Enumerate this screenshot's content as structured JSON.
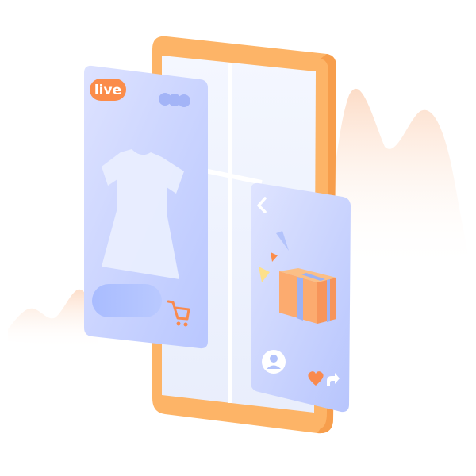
{
  "live_card": {
    "badge_text": "live",
    "badge_color": "#fb8c4a",
    "icons": [
      "dress-icon",
      "cart-icon"
    ]
  },
  "gift_card": {
    "icons": [
      "back-chevron-icon",
      "gift-box-icon",
      "avatar-icon",
      "heart-icon",
      "share-icon"
    ]
  },
  "colors": {
    "phone_frame": "#fdb467",
    "card_lavender": "#c9d3ff",
    "accent_orange": "#f98a4e",
    "backdrop_peach": "#fde6d8"
  }
}
